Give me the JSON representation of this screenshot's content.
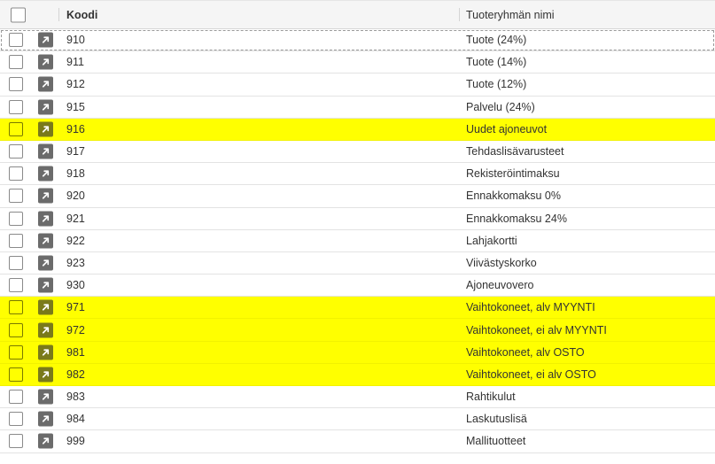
{
  "header": {
    "col_code": "Koodi",
    "col_name": "Tuoteryhmän nimi"
  },
  "colors": {
    "highlight": "#ffff00",
    "icon_bg": "#6b6b6b"
  },
  "row_icon": "open-record-arrow-icon",
  "rows": [
    {
      "code": "910",
      "name": "Tuote (24%)",
      "highlight": false
    },
    {
      "code": "911",
      "name": "Tuote (14%)",
      "highlight": false
    },
    {
      "code": "912",
      "name": "Tuote (12%)",
      "highlight": false
    },
    {
      "code": "915",
      "name": "Palvelu (24%)",
      "highlight": false
    },
    {
      "code": "916",
      "name": "Uudet ajoneuvot",
      "highlight": true
    },
    {
      "code": "917",
      "name": "Tehdaslisävarusteet",
      "highlight": false
    },
    {
      "code": "918",
      "name": "Rekisteröintimaksu",
      "highlight": false
    },
    {
      "code": "920",
      "name": "Ennakkomaksu 0%",
      "highlight": false
    },
    {
      "code": "921",
      "name": "Ennakkomaksu 24%",
      "highlight": false
    },
    {
      "code": "922",
      "name": "Lahjakortti",
      "highlight": false
    },
    {
      "code": "923",
      "name": "Viivästyskorko",
      "highlight": false
    },
    {
      "code": "930",
      "name": "Ajoneuvovero",
      "highlight": false
    },
    {
      "code": "971",
      "name": "Vaihtokoneet, alv MYYNTI",
      "highlight": true
    },
    {
      "code": "972",
      "name": "Vaihtokoneet, ei alv MYYNTI",
      "highlight": true
    },
    {
      "code": "981",
      "name": "Vaihtokoneet, alv OSTO",
      "highlight": true
    },
    {
      "code": "982",
      "name": "Vaihtokoneet, ei alv OSTO",
      "highlight": true
    },
    {
      "code": "983",
      "name": "Rahtikulut",
      "highlight": false
    },
    {
      "code": "984",
      "name": "Laskutuslisä",
      "highlight": false
    },
    {
      "code": "999",
      "name": "Mallituotteet",
      "highlight": false
    }
  ]
}
